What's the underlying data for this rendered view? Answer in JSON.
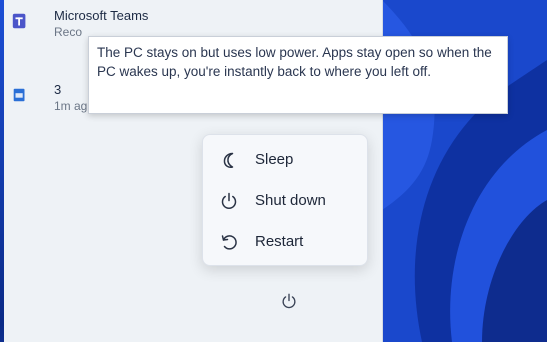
{
  "apps": [
    {
      "name": "Microsoft Teams",
      "sub": "Reco",
      "icon": "teams-icon"
    },
    {
      "name": "3",
      "sub": "1m ag",
      "icon": "app-icon"
    }
  ],
  "tooltip": {
    "text": "The PC stays on but uses low power. Apps stay open so when the PC wakes up, you're instantly back to where you left off."
  },
  "power_menu": {
    "items": [
      {
        "label": "Sleep",
        "icon": "sleep-icon"
      },
      {
        "label": "Shut down",
        "icon": "power-icon"
      },
      {
        "label": "Restart",
        "icon": "restart-icon"
      }
    ]
  },
  "power_button": {
    "icon": "power-icon"
  },
  "colors": {
    "accent": "#1c4fd6",
    "menu_bg": "#f6f8fb",
    "start_bg": "#eef2f6"
  }
}
